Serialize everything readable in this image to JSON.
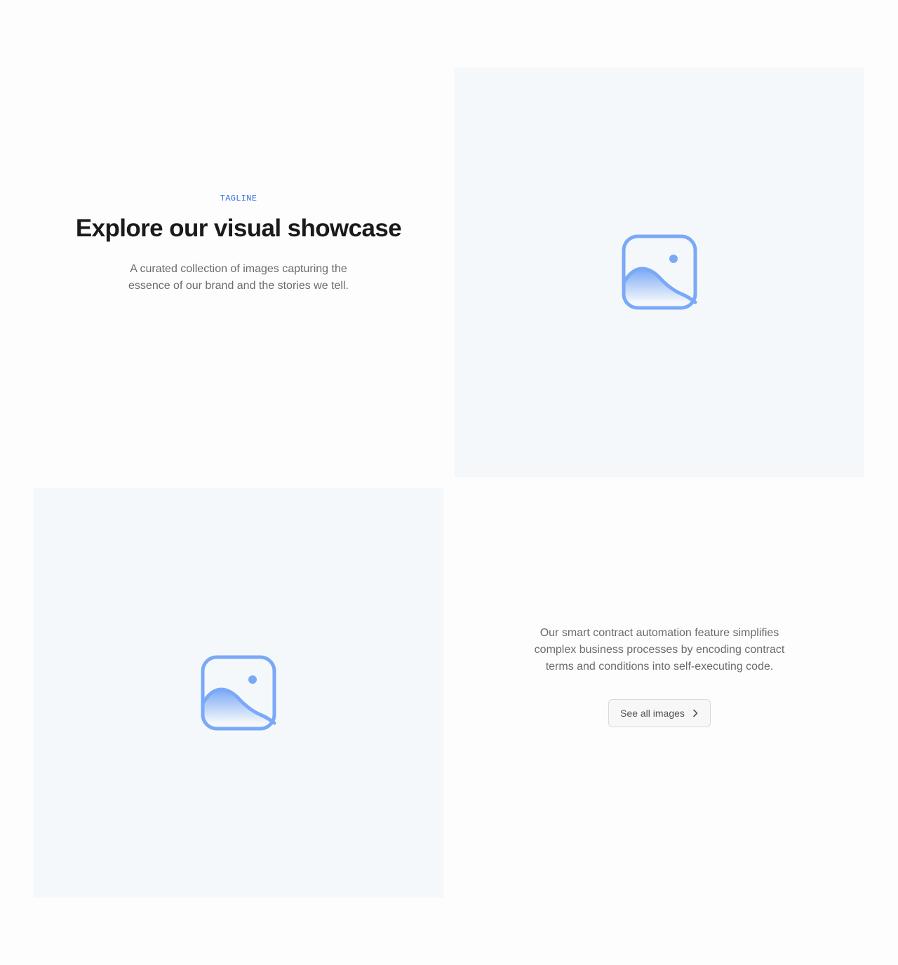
{
  "hero": {
    "tagline": "TAGLINE",
    "headline": "Explore our visual showcase",
    "lead": "A curated collection of images capturing the essence of our brand and the stories we tell."
  },
  "feature": {
    "description": "Our smart contract automation feature simplifies complex business processes by encoding contract terms and conditions into self-executing code.",
    "cta_label": "See all images",
    "cta_icon": "chevron-right-icon"
  },
  "placeholders": [
    {
      "icon": "image-placeholder-icon"
    },
    {
      "icon": "image-placeholder-icon"
    }
  ],
  "colors": {
    "accent": "#2f6fe6",
    "icon": "#7aa9f7",
    "media_bg": "#f5f8fb",
    "heading": "#1a1a1a",
    "body": "#6b6b6b"
  }
}
